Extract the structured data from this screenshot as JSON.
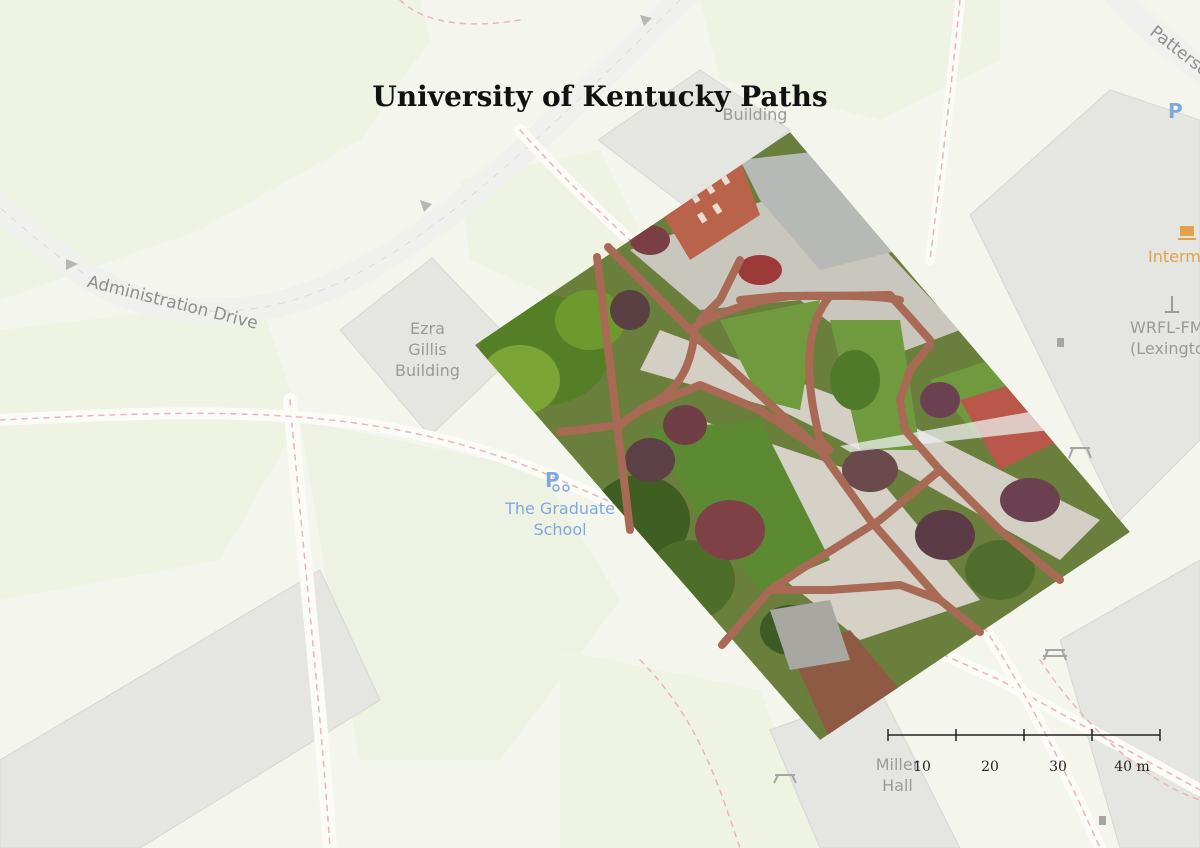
{
  "title": "University of Kentucky Paths",
  "basemap": {
    "buildings": [
      {
        "name": "ezra-gillis-building",
        "label": "Ezra\nGillis\nBuilding"
      },
      {
        "name": "building-top",
        "label": "Building"
      },
      {
        "name": "miller-hall",
        "label": "Miller\nHall"
      },
      {
        "name": "wrfl-fm",
        "label": "WRFL-FM\n(Lexington)"
      }
    ],
    "roads": [
      {
        "name": "administration-drive",
        "label": "Administration Drive"
      },
      {
        "name": "patterson-drive",
        "label": "Patterson"
      }
    ],
    "pois": [
      {
        "name": "graduate-school",
        "label": "The Graduate\nSchool",
        "icon": "bicycle-parking-icon",
        "color": "#7fa9dd"
      },
      {
        "name": "intermezzo",
        "label": "Interm",
        "icon": "cafe-icon",
        "color": "#e2a24a"
      }
    ]
  },
  "layers": {
    "imagery": "aerial drone orthophoto of campus plaza",
    "paths_color": "#a86a54"
  },
  "scale_bar": {
    "unit": "m",
    "ticks": [
      "10",
      "20",
      "30",
      "40 m"
    ]
  }
}
